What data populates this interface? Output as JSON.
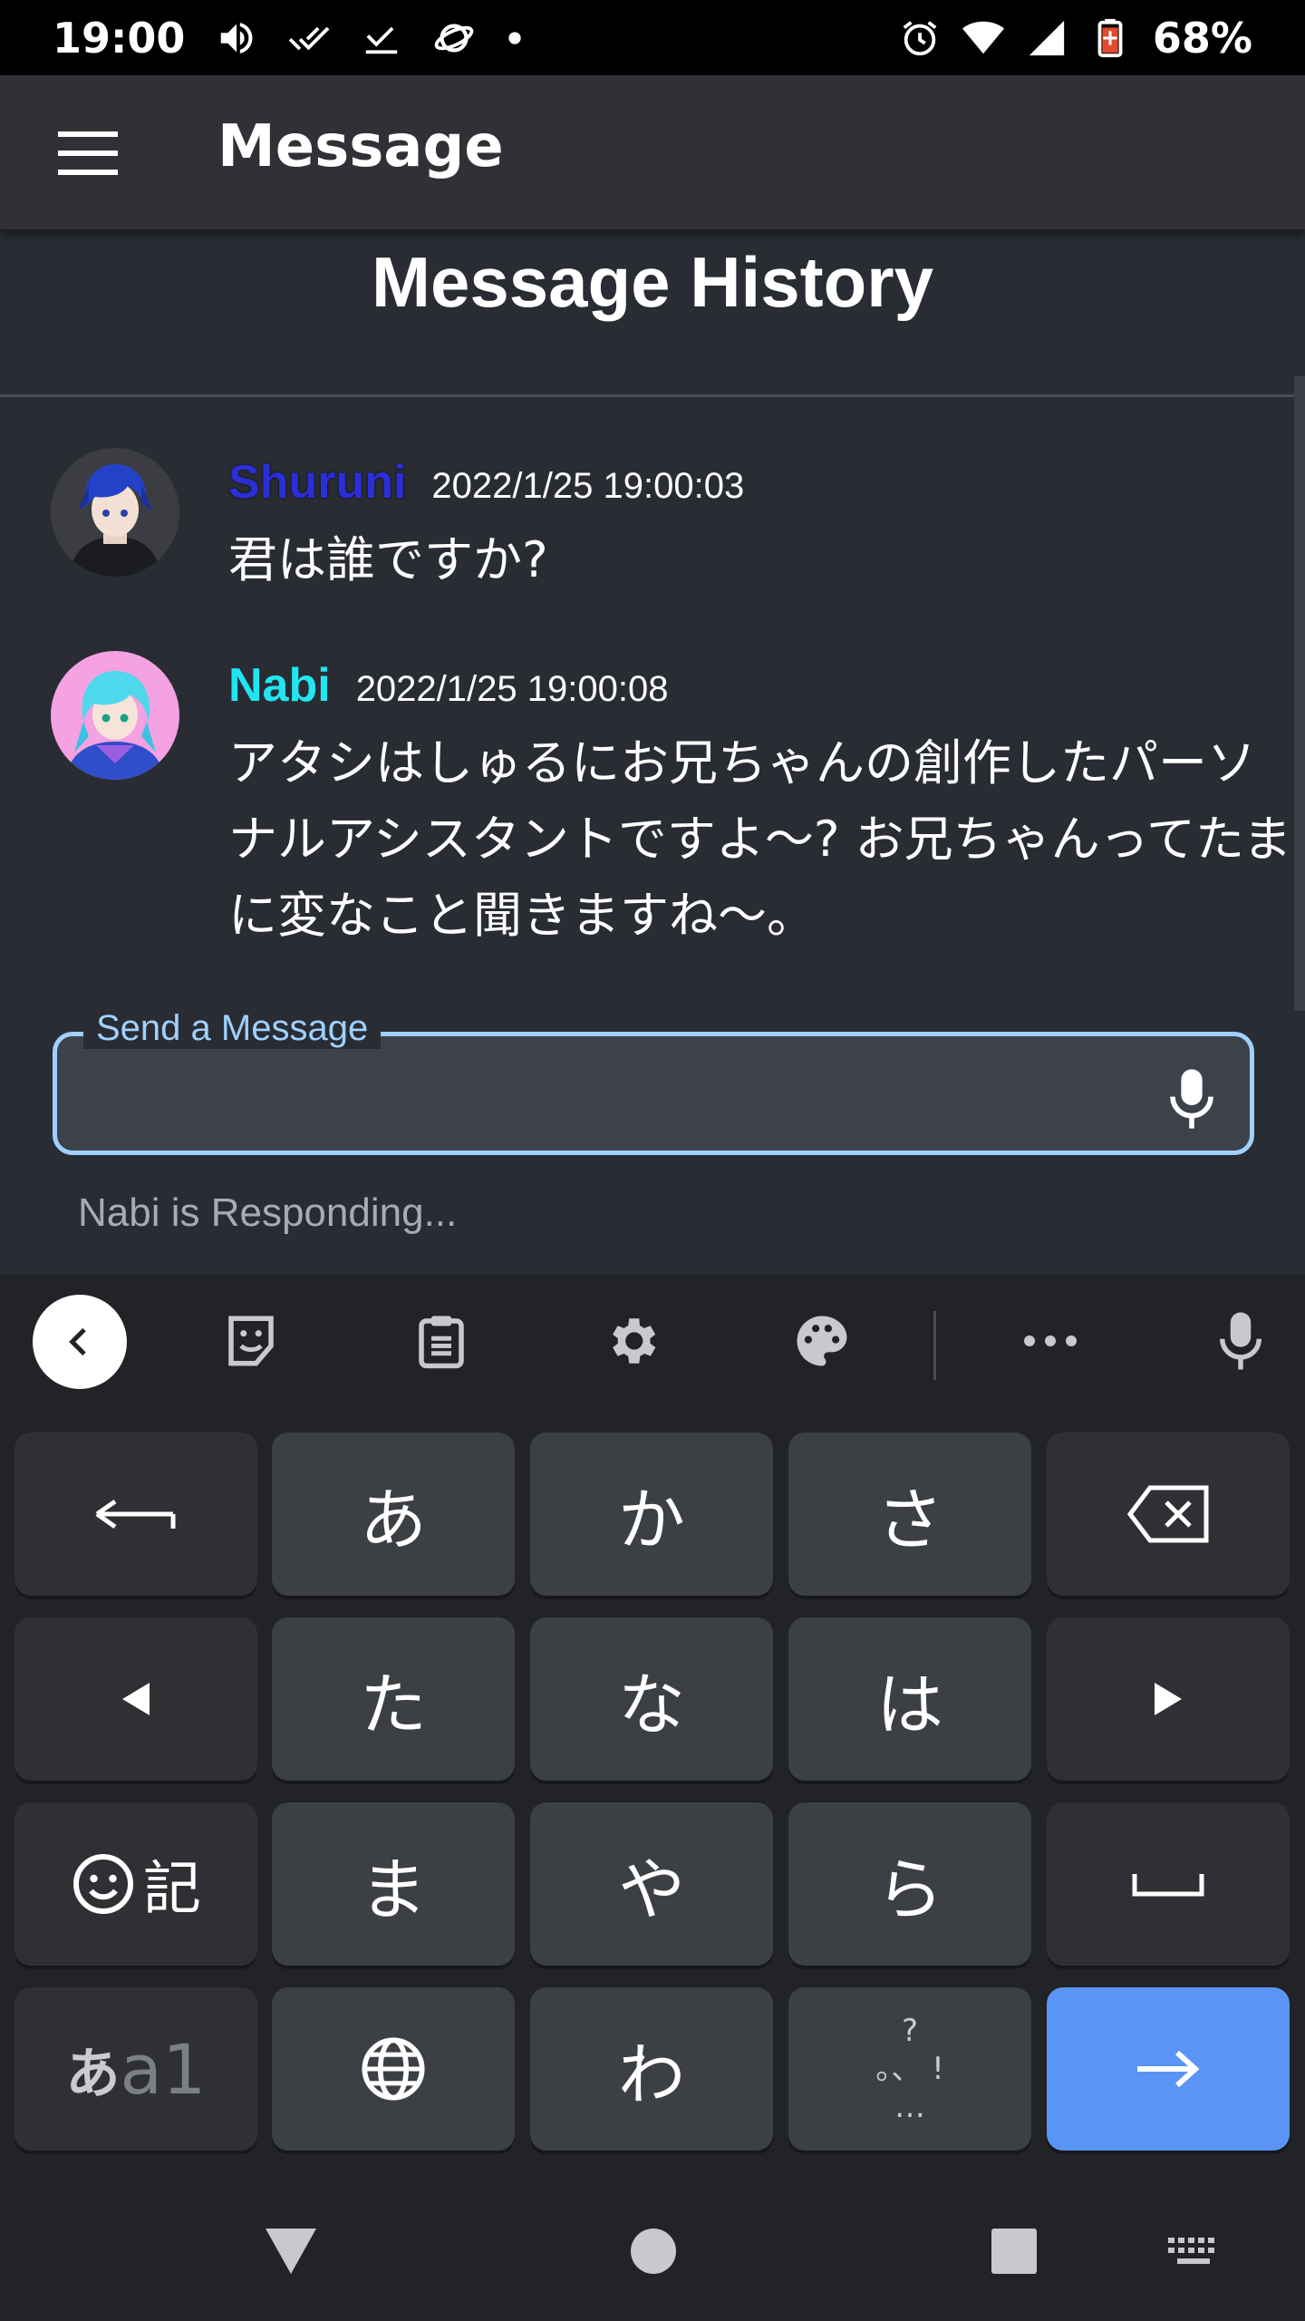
{
  "status_bar": {
    "time": "19:00",
    "battery": "68%",
    "left_icons": [
      "volume-icon",
      "double-check-icon",
      "check-icon",
      "planet-icon",
      "dot-icon"
    ],
    "right_icons": [
      "alarm-icon",
      "wifi-icon",
      "signal-icon",
      "battery-icon"
    ]
  },
  "app_bar": {
    "title": "Message",
    "menu_icon": "menu-icon"
  },
  "history": {
    "title": "Message History",
    "messages": [
      {
        "sender": "Shuruni",
        "sender_color": "#2b2fd6",
        "timestamp": "2022/1/25 19:00:03",
        "text": "君は誰ですか?"
      },
      {
        "sender": "Nabi",
        "sender_color": "#22e5f2",
        "timestamp": "2022/1/25 19:00:08",
        "text": "アタシはしゅるにお兄ちゃんの創作したパーソナルアシスタントですよ〜? お兄ちゃんってたまに変なこと聞きますね〜。"
      }
    ]
  },
  "input": {
    "label": "Send a Message",
    "value": "",
    "placeholder": "",
    "mic_icon": "microphone-icon"
  },
  "status_text": "Nabi is Responding...",
  "keyboard": {
    "toolbar_icons": [
      "chevron-left-icon",
      "sticker-icon",
      "clipboard-icon",
      "gear-icon",
      "palette-icon",
      "more-icon",
      "microphone-icon"
    ],
    "keys": {
      "a": "あ",
      "ka": "か",
      "sa": "さ",
      "ta": "た",
      "na": "な",
      "ha": "は",
      "ma": "ま",
      "ya": "や",
      "ra": "ら",
      "wa": "わ",
      "emoji_kigou": "記",
      "mode_kana": "あ",
      "mode_alpha": "a1",
      "punct_top": "?",
      "punct_mid": "。、 !",
      "punct_bottom": "…"
    },
    "enter_color": "#5a95f5"
  },
  "nav_bar": {
    "buttons": [
      "back-triangle-icon",
      "home-circle-icon",
      "recents-square-icon",
      "keyboard-icon"
    ]
  }
}
